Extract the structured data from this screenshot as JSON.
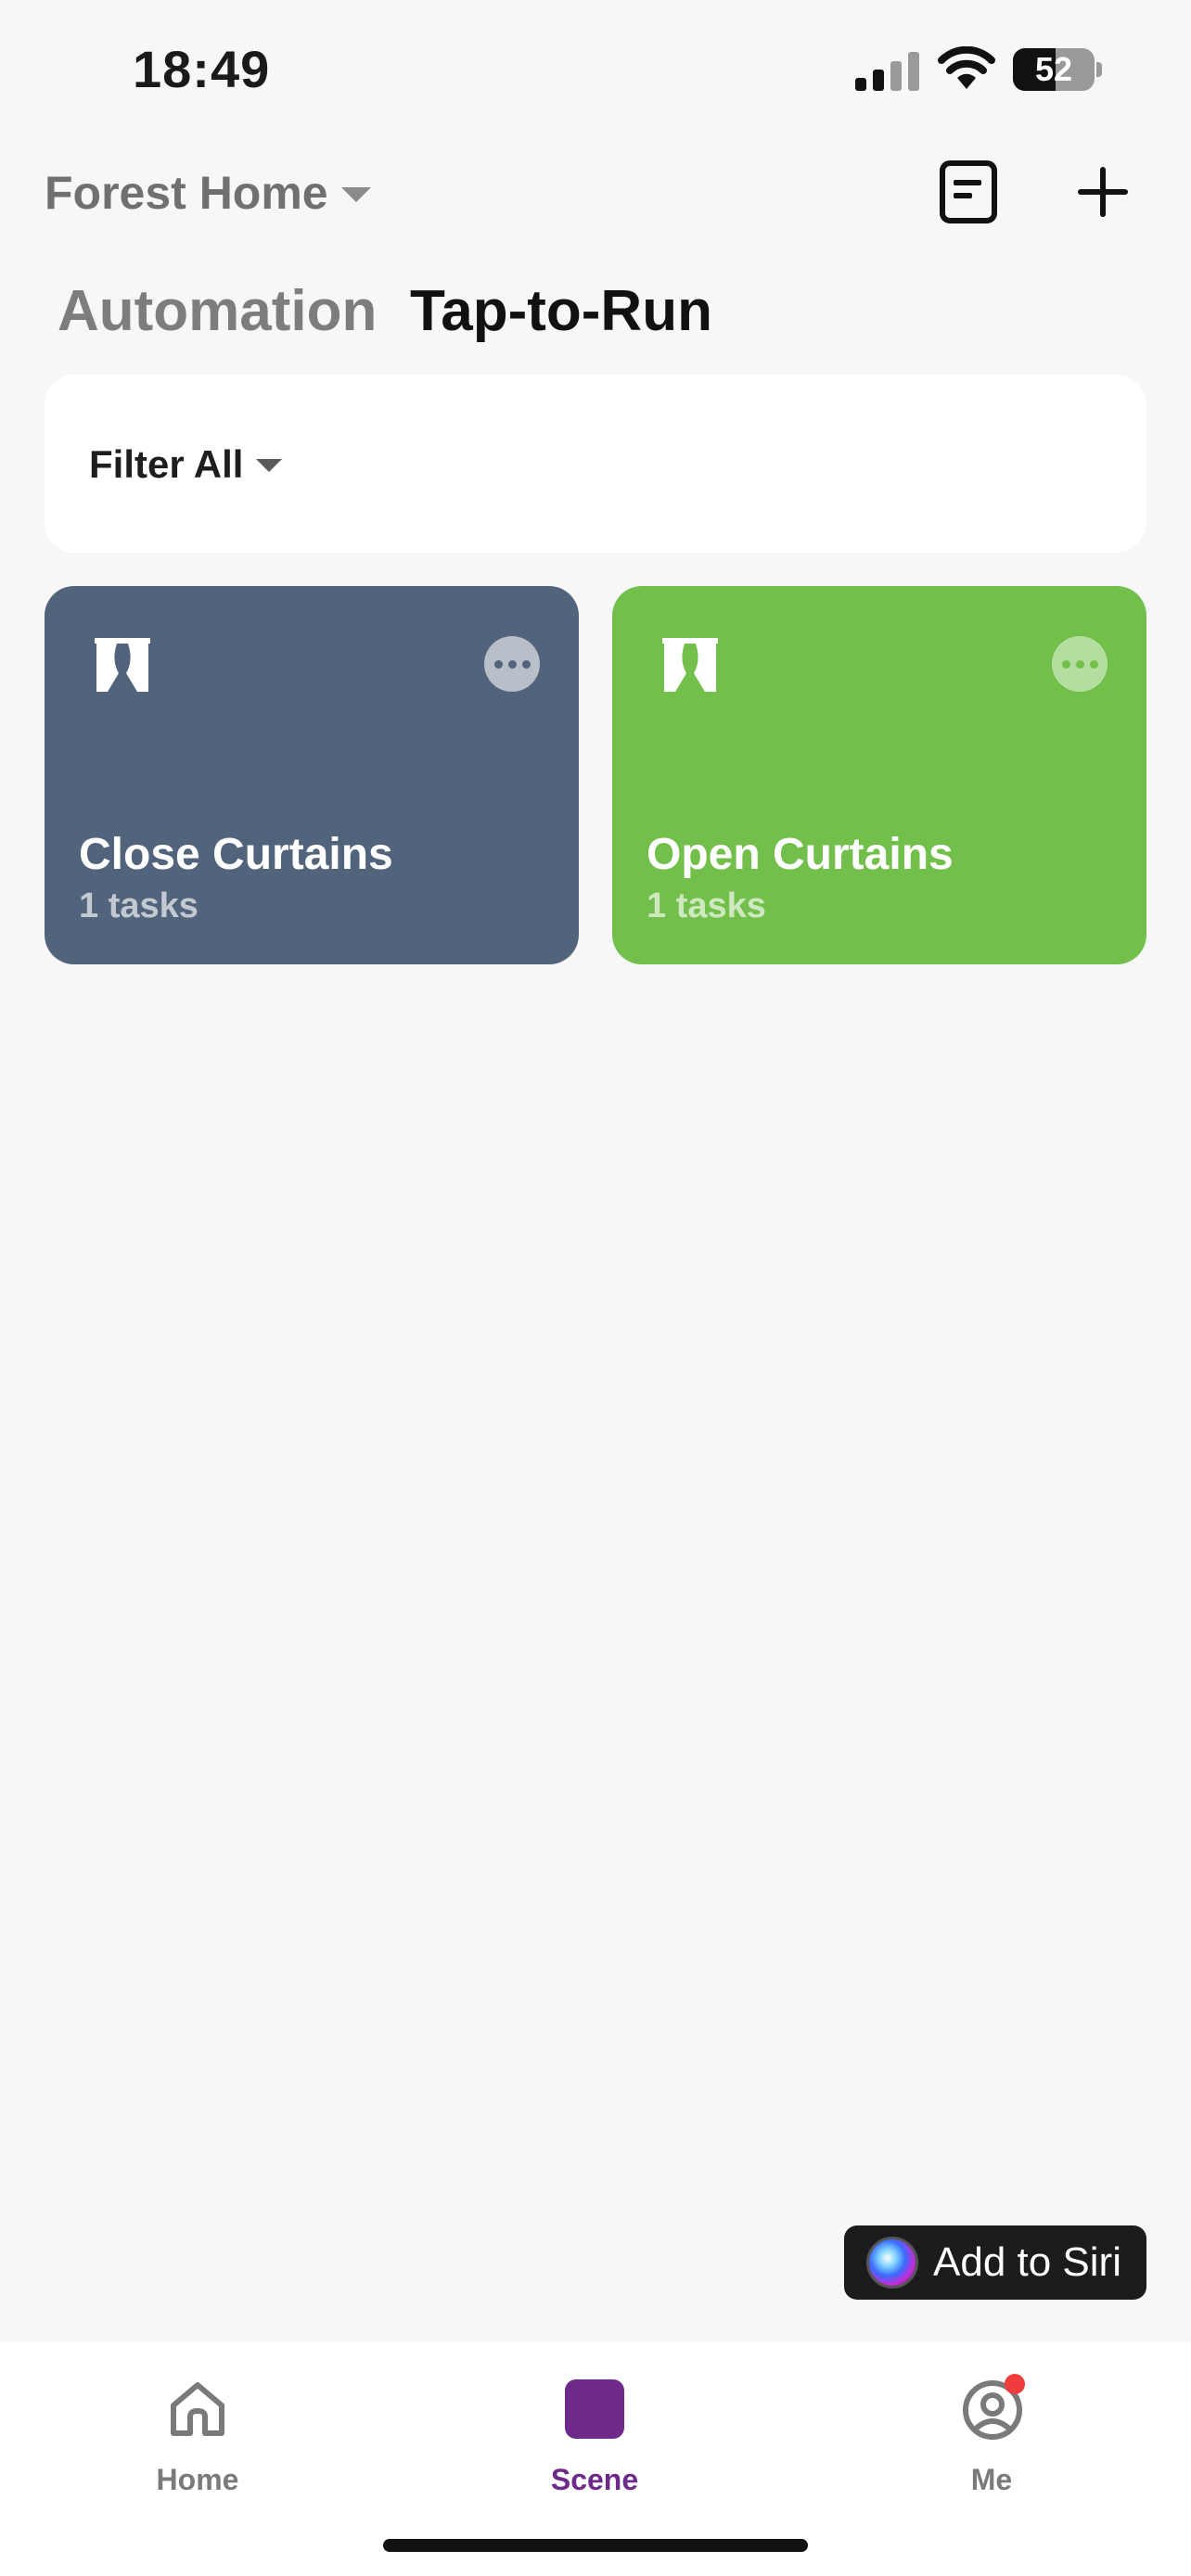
{
  "status_bar": {
    "time": "18:49",
    "battery_percent": "52",
    "icons": [
      "signal-icon",
      "wifi-icon",
      "battery-icon"
    ]
  },
  "header": {
    "home_name": "Forest Home",
    "icons": [
      "caret-down-icon",
      "log-icon",
      "plus-icon"
    ]
  },
  "tabs": [
    {
      "label": "Automation",
      "active": false
    },
    {
      "label": "Tap-to-Run",
      "active": true
    }
  ],
  "filter": {
    "label": "Filter All"
  },
  "scenes": [
    {
      "title": "Close Curtains",
      "subtitle": "1 tasks",
      "color": "#51647b",
      "icon": "curtain-icon"
    },
    {
      "title": "Open Curtains",
      "subtitle": "1 tasks",
      "color": "#72c04b",
      "icon": "curtain-icon"
    }
  ],
  "siri": {
    "label": "Add to Siri",
    "icon": "siri-icon"
  },
  "nav": [
    {
      "label": "Home",
      "icon": "home-icon",
      "active": false
    },
    {
      "label": "Scene",
      "icon": "scene-check-icon",
      "active": true
    },
    {
      "label": "Me",
      "icon": "profile-icon",
      "active": false,
      "badge": true
    }
  ],
  "colors": {
    "accent": "#6d2a8a",
    "badge": "#f03c3c",
    "background": "#f7f7f7"
  }
}
